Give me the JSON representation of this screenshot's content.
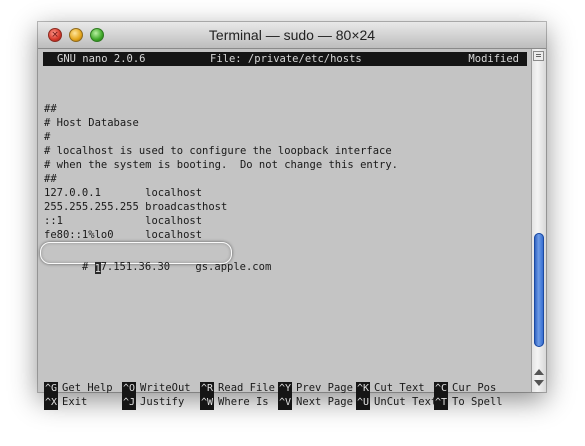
{
  "window": {
    "title": "Terminal — sudo — 80×24"
  },
  "nano": {
    "version": "GNU nano 2.0.6",
    "file": "File: /private/etc/hosts",
    "status": "Modified"
  },
  "file_lines": [
    "##",
    "# Host Database",
    "#",
    "# localhost is used to configure the loopback interface",
    "# when the system is booting.  Do not change this entry.",
    "##",
    "127.0.0.1       localhost",
    "255.255.255.255 broadcasthost",
    "::1             localhost",
    "fe80::1%lo0     localhost"
  ],
  "highlighted_line": {
    "prefix": "# ",
    "cursor_char": "1",
    "rest": "7.151.36.30    gs.apple.com"
  },
  "shortcuts": {
    "row1": [
      {
        "key": "^G",
        "label": "Get Help"
      },
      {
        "key": "^O",
        "label": "WriteOut"
      },
      {
        "key": "^R",
        "label": "Read File"
      },
      {
        "key": "^Y",
        "label": "Prev Page"
      },
      {
        "key": "^K",
        "label": "Cut Text"
      },
      {
        "key": "^C",
        "label": "Cur Pos"
      }
    ],
    "row2": [
      {
        "key": "^X",
        "label": "Exit"
      },
      {
        "key": "^J",
        "label": "Justify"
      },
      {
        "key": "^W",
        "label": "Where Is"
      },
      {
        "key": "^V",
        "label": "Next Page"
      },
      {
        "key": "^U",
        "label": "UnCut Text"
      },
      {
        "key": "^T",
        "label": "To Spell"
      }
    ]
  },
  "colors": {
    "terminal_bg": "#c4c4c4",
    "bar_bg": "#151515",
    "scroll_thumb": "#2b64cc"
  }
}
